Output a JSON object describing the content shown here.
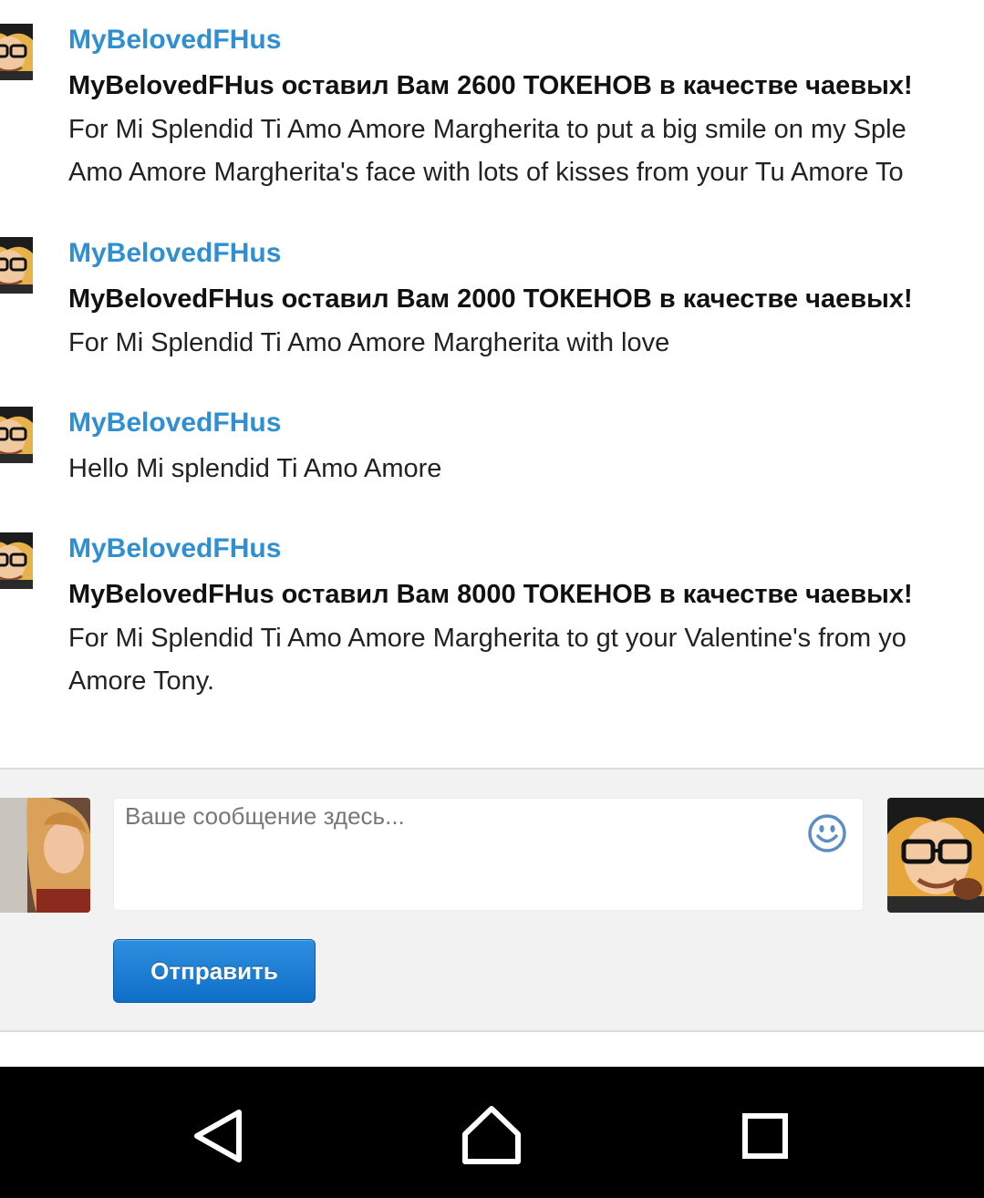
{
  "messages": [
    {
      "author": "MyBelovedFHus",
      "tip": "MyBelovedFHus оставил Вам 2600 ТОКЕНОВ в качестве чаевых!",
      "lines": [
        "For Mi Splendid Ti Amo Amore Margherita to put a big smile on my Sple",
        "Amo Amore Margherita's face with lots of kisses from your Tu Amore To"
      ]
    },
    {
      "author": "MyBelovedFHus",
      "tip": "MyBelovedFHus оставил Вам 2000 ТОКЕНОВ в качестве чаевых!",
      "lines": [
        "For Mi Splendid Ti Amo Amore Margherita with love"
      ]
    },
    {
      "author": "MyBelovedFHus",
      "lines": [
        "Hello Mi splendid Ti Amo Amore"
      ]
    },
    {
      "author": "MyBelovedFHus",
      "tip": "MyBelovedFHus оставил Вам 8000 ТОКЕНОВ в качестве чаевых!",
      "lines": [
        "For Mi Splendid Ti Amo Amore Margherita to gt your Valentine's from yo",
        "Amore Tony."
      ]
    }
  ],
  "composer": {
    "placeholder": "Ваше сообщение здесь...",
    "send_label": "Отправить",
    "emoji_icon": "smiley-icon"
  },
  "navbar": {
    "icons": [
      "back-icon",
      "home-icon",
      "recents-icon"
    ]
  },
  "colors": {
    "author": "#2f8fd3",
    "button": "#1a7fd6",
    "navbar": "#000000",
    "composer_bg": "#f2f2f2"
  }
}
